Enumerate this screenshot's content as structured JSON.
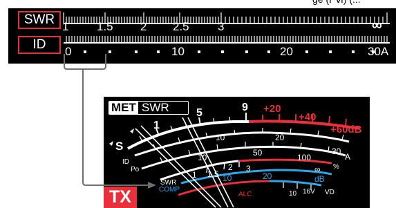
{
  "header_cut_text": "ge (Pⅵ) (...",
  "bar_meter": {
    "swr_label": "SWR",
    "id_label": "ID",
    "swr_ticks": [
      "1",
      "1.5",
      "2",
      "2.5",
      "3",
      "∞"
    ],
    "id_ticks": [
      "0",
      "10",
      "20",
      "30A"
    ]
  },
  "analog_meter": {
    "mode_badge": "MET",
    "meter_name": "SWR",
    "s_scale": [
      "S",
      "1",
      "5",
      "9",
      "+20",
      "+40",
      "+60dB"
    ],
    "po_scale": [
      "10",
      "20"
    ],
    "id_scale": [
      "10",
      "50",
      "100",
      "30",
      "A"
    ],
    "swr_scale": [
      "1",
      "1.5",
      "2",
      "3",
      "∞"
    ],
    "comp_scale": [
      "10",
      "20",
      "dB"
    ],
    "vd_scale": [
      "10",
      "16V"
    ],
    "label_id": "ID",
    "label_po": "Po",
    "label_pct": "%",
    "label_vd": "VD",
    "label_alc": "ALC",
    "label_swr": "SWR",
    "label_comp": "COMP",
    "tx_indicator": "TX"
  },
  "colors": {
    "frame_red": "#e8303a",
    "meter_red": "#e8303a",
    "meter_blue": "#2ea7ea",
    "arrow_gray": "#6d6f70"
  }
}
